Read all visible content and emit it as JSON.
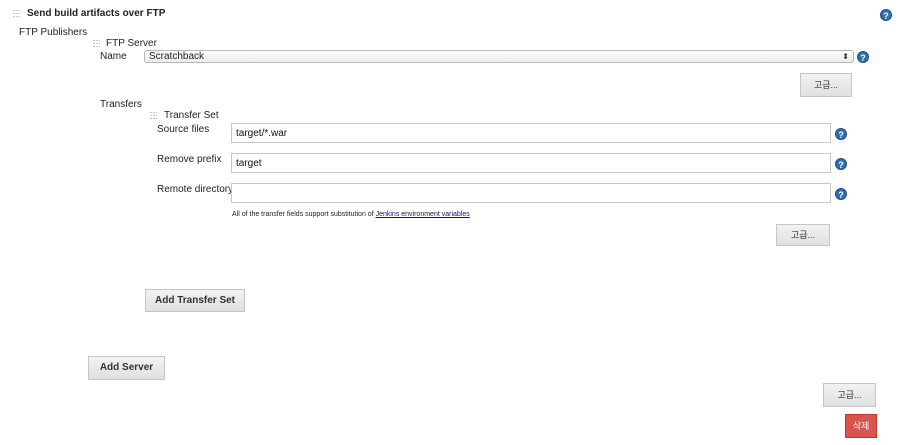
{
  "section": {
    "title": "Send build artifacts over FTP",
    "help": "?"
  },
  "publishers_label": "FTP Publishers",
  "ftp_server": {
    "header": "FTP Server",
    "name_label": "Name",
    "name_value": "Scratchback",
    "advanced_button": "고급..."
  },
  "transfers": {
    "label": "Transfers",
    "set_header": "Transfer Set",
    "source_files_label": "Source files",
    "source_files_value": "target/*.war",
    "remove_prefix_label": "Remove prefix",
    "remove_prefix_value": "target",
    "remote_directory_label": "Remote directory",
    "remote_directory_value": "",
    "note_prefix": "All of the transfer fields support substitution of ",
    "note_link": "Jenkins environment variables",
    "advanced_button": "고급...",
    "add_transfer_set_button": "Add Transfer Set"
  },
  "add_server_button": "Add Server",
  "bottom_advanced_button": "고급...",
  "delete_button": "삭제",
  "colors": {
    "help_blue": "#2f6fb0",
    "delete_red": "#d9534f",
    "link_purple": "#2a0a6b"
  }
}
